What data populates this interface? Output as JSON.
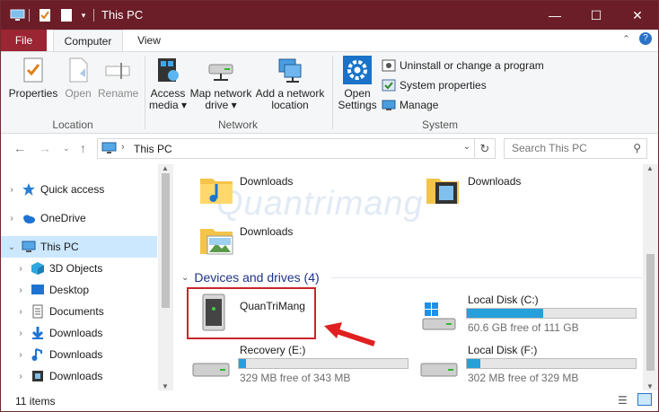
{
  "window": {
    "title": "This PC"
  },
  "titlebar_controls": {
    "minimize": "—",
    "maximize": "☐",
    "close": "✕"
  },
  "tabs": {
    "file": "File",
    "computer": "Computer",
    "view": "View"
  },
  "ribbon": {
    "location": {
      "group_label": "Location",
      "properties": "Properties",
      "open": "Open",
      "rename": "Rename"
    },
    "network": {
      "group_label": "Network",
      "access_media": [
        "Access",
        "media ▾"
      ],
      "map_network_drive": [
        "Map network",
        "drive ▾"
      ],
      "add_network_location": [
        "Add a network",
        "location"
      ]
    },
    "system": {
      "group_label": "System",
      "open_settings": [
        "Open",
        "Settings"
      ],
      "uninstall": "Uninstall or change a program",
      "system_properties": "System properties",
      "manage": "Manage"
    }
  },
  "address": {
    "path": "This PC",
    "separator": "›",
    "search_placeholder": "Search This PC"
  },
  "nav": {
    "items": [
      {
        "label": "Quick access",
        "icon": "star-icon"
      },
      {
        "label": "OneDrive",
        "icon": "cloud-icon"
      },
      {
        "label": "This PC",
        "icon": "computer-icon"
      },
      {
        "label": "3D Objects",
        "icon": "cube-icon"
      },
      {
        "label": "Desktop",
        "icon": "desktop-icon"
      },
      {
        "label": "Documents",
        "icon": "document-icon"
      },
      {
        "label": "Downloads",
        "icon": "download-icon"
      },
      {
        "label": "Downloads",
        "icon": "music-icon"
      },
      {
        "label": "Downloads",
        "icon": "video-icon"
      }
    ]
  },
  "folders": [
    {
      "name": "Downloads",
      "icon": "music-folder-icon"
    },
    {
      "name": "Downloads",
      "icon": "video-folder-icon"
    },
    {
      "name": "Downloads",
      "icon": "picture-folder-icon"
    }
  ],
  "devices": {
    "section_label": "Devices and drives (4)",
    "items": [
      {
        "name": "QuanTriMang",
        "icon": "media-server-icon"
      },
      {
        "name": "Local Disk (C:)",
        "free": "60.6 GB free of 111 GB",
        "used_fraction": 0.45,
        "icon": "windows-disk-icon"
      },
      {
        "name": "Recovery (E:)",
        "free": "329 MB free of 343 MB",
        "used_fraction": 0.04,
        "icon": "disk-icon"
      },
      {
        "name": "Local Disk (F:)",
        "free": "302 MB free of 329 MB",
        "used_fraction": 0.08,
        "icon": "disk-icon"
      }
    ]
  },
  "watermark": "Quantrimang",
  "status": {
    "items_count": "11 items"
  },
  "colors": {
    "titlebar": "#6b1e27",
    "file_tab": "#9b2532",
    "selection": "#cce8ff",
    "drive_bar": "#26a0da",
    "highlight": "#c9252b",
    "section_text": "#1e3287"
  }
}
